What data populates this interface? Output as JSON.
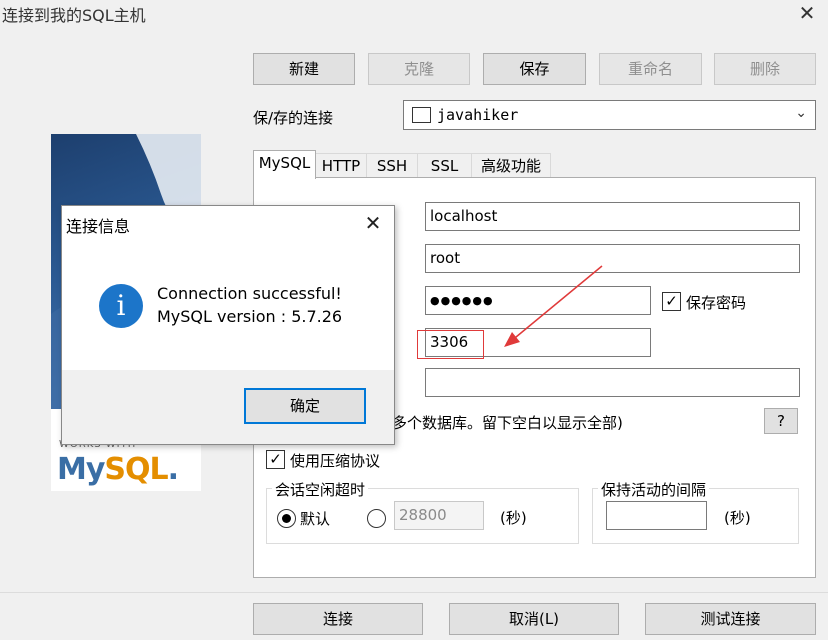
{
  "window": {
    "title": "连接到我的SQL主机",
    "close_glyph": "✕"
  },
  "toolbar": {
    "new_label": "新建",
    "clone_label": "克隆",
    "save_label": "保存",
    "rename_label": "重命名",
    "delete_label": "删除"
  },
  "saved_connections": {
    "label": "保/存的连接",
    "selected": "javahiker"
  },
  "tabs": [
    {
      "label": "MySQL",
      "active": true
    },
    {
      "label": "HTTP",
      "active": false
    },
    {
      "label": "SSH",
      "active": false
    },
    {
      "label": "SSL",
      "active": false
    },
    {
      "label": "高级功能",
      "active": false
    }
  ],
  "mysql": {
    "host": "localhost",
    "user": "root",
    "password_mask": "●●●●●●",
    "save_password_checked": true,
    "save_password_label": "保存密码",
    "port": "3306",
    "database": "",
    "database_hint_visible": "多个数据库。留下空白以显示全部)",
    "hint_button": "?",
    "compression_checked": true,
    "compression_label": "使用压缩协议",
    "session_timeout": {
      "label": "会话空闲超时",
      "default_label": "默认",
      "default_selected": true,
      "value": "28800",
      "unit": "(秒)"
    },
    "keepalive": {
      "label": "保持活动的间隔",
      "value": "",
      "unit": "(秒)"
    }
  },
  "dialog": {
    "title": "连接信息",
    "close_glyph": "✕",
    "icon": "info-icon",
    "line1": "Connection successful!",
    "line2": "MySQL version : 5.7.26",
    "ok_label": "确定"
  },
  "logo": {
    "works_with": "WORKS WITH",
    "brand_prefix": "My",
    "brand_mid": "SQL",
    "brand_suffix": "."
  },
  "bottom": {
    "connect_label": "连接",
    "cancel_label": "取消(L)",
    "test_label": "测试连接"
  },
  "colors": {
    "accent": "#0078d7",
    "annotation_red": "#e03a3a",
    "info_blue": "#1c75c9"
  }
}
